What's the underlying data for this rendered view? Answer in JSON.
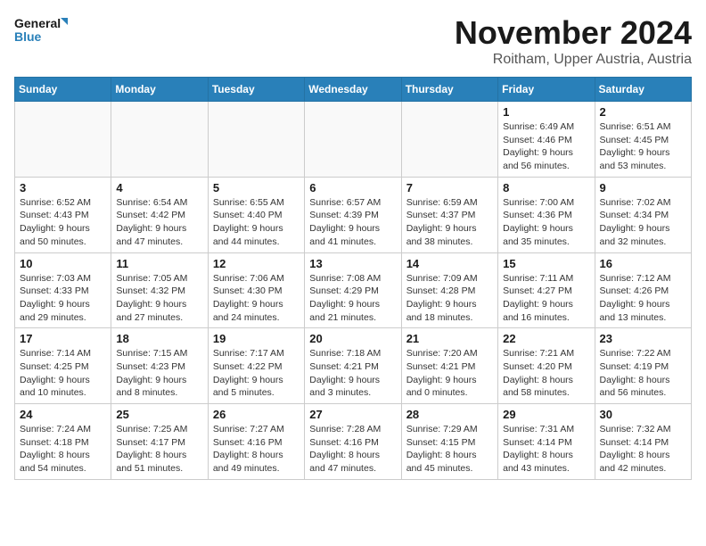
{
  "logo": {
    "line1": "General",
    "line2": "Blue"
  },
  "header": {
    "month": "November 2024",
    "location": "Roitham, Upper Austria, Austria"
  },
  "weekdays": [
    "Sunday",
    "Monday",
    "Tuesday",
    "Wednesday",
    "Thursday",
    "Friday",
    "Saturday"
  ],
  "weeks": [
    [
      {
        "day": "",
        "info": ""
      },
      {
        "day": "",
        "info": ""
      },
      {
        "day": "",
        "info": ""
      },
      {
        "day": "",
        "info": ""
      },
      {
        "day": "",
        "info": ""
      },
      {
        "day": "1",
        "info": "Sunrise: 6:49 AM\nSunset: 4:46 PM\nDaylight: 9 hours\nand 56 minutes."
      },
      {
        "day": "2",
        "info": "Sunrise: 6:51 AM\nSunset: 4:45 PM\nDaylight: 9 hours\nand 53 minutes."
      }
    ],
    [
      {
        "day": "3",
        "info": "Sunrise: 6:52 AM\nSunset: 4:43 PM\nDaylight: 9 hours\nand 50 minutes."
      },
      {
        "day": "4",
        "info": "Sunrise: 6:54 AM\nSunset: 4:42 PM\nDaylight: 9 hours\nand 47 minutes."
      },
      {
        "day": "5",
        "info": "Sunrise: 6:55 AM\nSunset: 4:40 PM\nDaylight: 9 hours\nand 44 minutes."
      },
      {
        "day": "6",
        "info": "Sunrise: 6:57 AM\nSunset: 4:39 PM\nDaylight: 9 hours\nand 41 minutes."
      },
      {
        "day": "7",
        "info": "Sunrise: 6:59 AM\nSunset: 4:37 PM\nDaylight: 9 hours\nand 38 minutes."
      },
      {
        "day": "8",
        "info": "Sunrise: 7:00 AM\nSunset: 4:36 PM\nDaylight: 9 hours\nand 35 minutes."
      },
      {
        "day": "9",
        "info": "Sunrise: 7:02 AM\nSunset: 4:34 PM\nDaylight: 9 hours\nand 32 minutes."
      }
    ],
    [
      {
        "day": "10",
        "info": "Sunrise: 7:03 AM\nSunset: 4:33 PM\nDaylight: 9 hours\nand 29 minutes."
      },
      {
        "day": "11",
        "info": "Sunrise: 7:05 AM\nSunset: 4:32 PM\nDaylight: 9 hours\nand 27 minutes."
      },
      {
        "day": "12",
        "info": "Sunrise: 7:06 AM\nSunset: 4:30 PM\nDaylight: 9 hours\nand 24 minutes."
      },
      {
        "day": "13",
        "info": "Sunrise: 7:08 AM\nSunset: 4:29 PM\nDaylight: 9 hours\nand 21 minutes."
      },
      {
        "day": "14",
        "info": "Sunrise: 7:09 AM\nSunset: 4:28 PM\nDaylight: 9 hours\nand 18 minutes."
      },
      {
        "day": "15",
        "info": "Sunrise: 7:11 AM\nSunset: 4:27 PM\nDaylight: 9 hours\nand 16 minutes."
      },
      {
        "day": "16",
        "info": "Sunrise: 7:12 AM\nSunset: 4:26 PM\nDaylight: 9 hours\nand 13 minutes."
      }
    ],
    [
      {
        "day": "17",
        "info": "Sunrise: 7:14 AM\nSunset: 4:25 PM\nDaylight: 9 hours\nand 10 minutes."
      },
      {
        "day": "18",
        "info": "Sunrise: 7:15 AM\nSunset: 4:23 PM\nDaylight: 9 hours\nand 8 minutes."
      },
      {
        "day": "19",
        "info": "Sunrise: 7:17 AM\nSunset: 4:22 PM\nDaylight: 9 hours\nand 5 minutes."
      },
      {
        "day": "20",
        "info": "Sunrise: 7:18 AM\nSunset: 4:21 PM\nDaylight: 9 hours\nand 3 minutes."
      },
      {
        "day": "21",
        "info": "Sunrise: 7:20 AM\nSunset: 4:21 PM\nDaylight: 9 hours\nand 0 minutes."
      },
      {
        "day": "22",
        "info": "Sunrise: 7:21 AM\nSunset: 4:20 PM\nDaylight: 8 hours\nand 58 minutes."
      },
      {
        "day": "23",
        "info": "Sunrise: 7:22 AM\nSunset: 4:19 PM\nDaylight: 8 hours\nand 56 minutes."
      }
    ],
    [
      {
        "day": "24",
        "info": "Sunrise: 7:24 AM\nSunset: 4:18 PM\nDaylight: 8 hours\nand 54 minutes."
      },
      {
        "day": "25",
        "info": "Sunrise: 7:25 AM\nSunset: 4:17 PM\nDaylight: 8 hours\nand 51 minutes."
      },
      {
        "day": "26",
        "info": "Sunrise: 7:27 AM\nSunset: 4:16 PM\nDaylight: 8 hours\nand 49 minutes."
      },
      {
        "day": "27",
        "info": "Sunrise: 7:28 AM\nSunset: 4:16 PM\nDaylight: 8 hours\nand 47 minutes."
      },
      {
        "day": "28",
        "info": "Sunrise: 7:29 AM\nSunset: 4:15 PM\nDaylight: 8 hours\nand 45 minutes."
      },
      {
        "day": "29",
        "info": "Sunrise: 7:31 AM\nSunset: 4:14 PM\nDaylight: 8 hours\nand 43 minutes."
      },
      {
        "day": "30",
        "info": "Sunrise: 7:32 AM\nSunset: 4:14 PM\nDaylight: 8 hours\nand 42 minutes."
      }
    ]
  ]
}
